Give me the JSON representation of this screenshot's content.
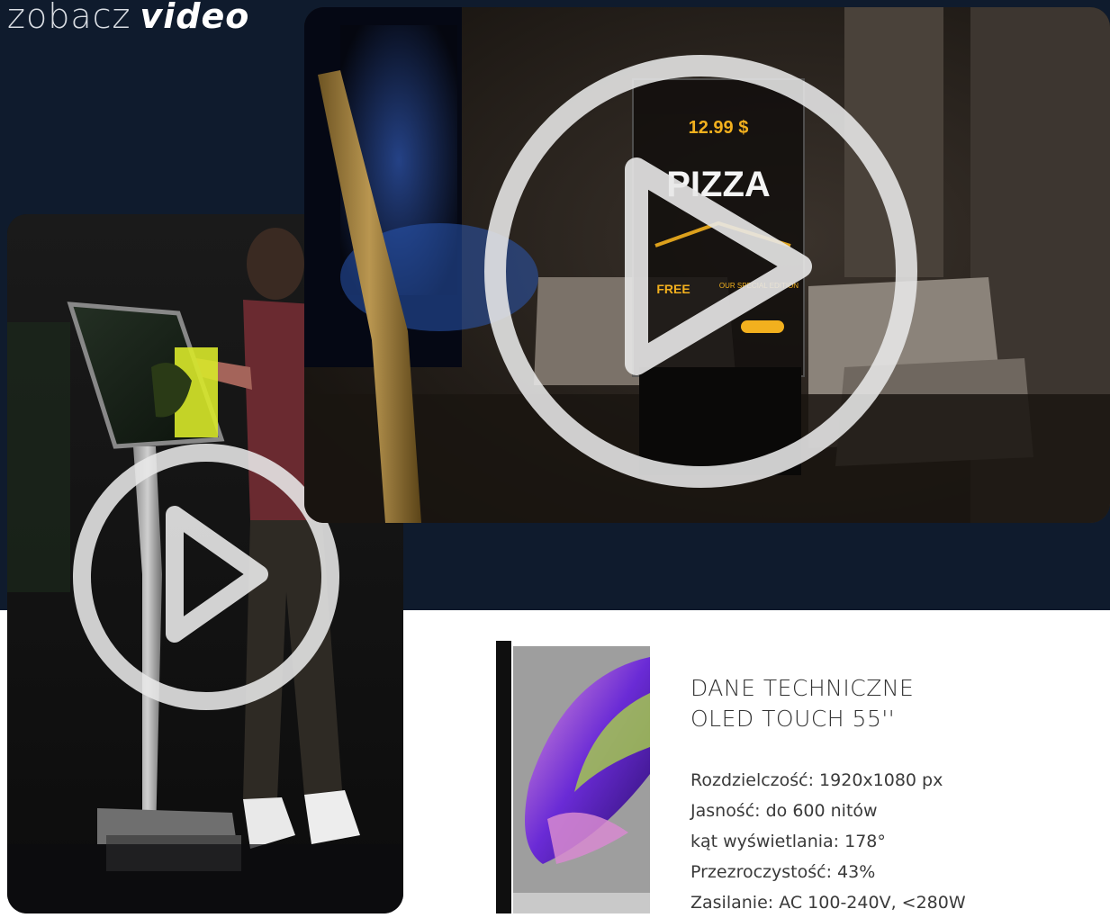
{
  "heading": {
    "light": "zobacz",
    "bold": "video"
  },
  "videos": [
    {
      "name": "kiosk-touch-video",
      "play_icon": "play-icon"
    },
    {
      "name": "oled-pizza-video",
      "play_icon": "play-icon",
      "screen": {
        "price": "12.99 $",
        "headline": "PIZZA",
        "promo": "FREE",
        "edition": "OUR SPECIAL EDITION"
      }
    }
  ],
  "specs": {
    "title_line1": "DANE TECHNICZNE",
    "title_line2": "OLED TOUCH 55''",
    "rows": [
      "Rozdzielczość: 1920x1080 px",
      "Jasność: do 600 nitów",
      "kąt wyświetlania: 178°",
      "Przezroczystość: 43%",
      "Zasilanie: AC 100-240V, <280W"
    ]
  },
  "colors": {
    "background_dark": "#0f1b2d",
    "accent_gold": "#f2b01e",
    "text": "#333333"
  }
}
